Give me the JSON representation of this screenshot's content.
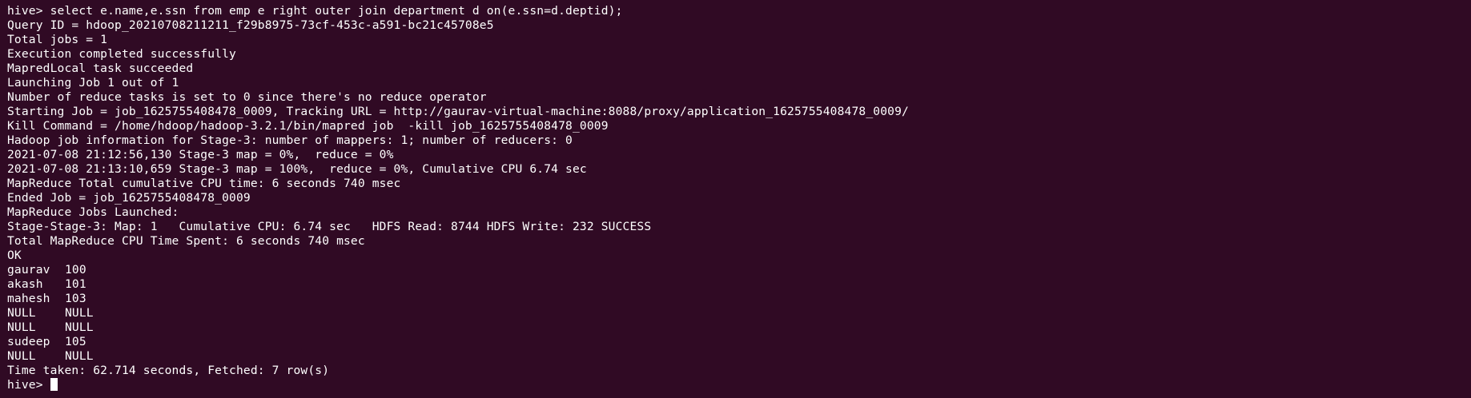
{
  "terminal": {
    "clipped_top_line": "",
    "lines_before_table": [
      "hive> select e.name,e.ssn from emp e right outer join department d on(e.ssn=d.deptid);",
      "Query ID = hdoop_20210708211211_f29b8975-73cf-453c-a591-bc21c45708e5",
      "Total jobs = 1",
      "Execution completed successfully",
      "MapredLocal task succeeded",
      "Launching Job 1 out of 1",
      "Number of reduce tasks is set to 0 since there's no reduce operator",
      "Starting Job = job_1625755408478_0009, Tracking URL = http://gaurav-virtual-machine:8088/proxy/application_1625755408478_0009/",
      "Kill Command = /home/hdoop/hadoop-3.2.1/bin/mapred job  -kill job_1625755408478_0009",
      "Hadoop job information for Stage-3: number of mappers: 1; number of reducers: 0",
      "2021-07-08 21:12:56,130 Stage-3 map = 0%,  reduce = 0%",
      "2021-07-08 21:13:10,659 Stage-3 map = 100%,  reduce = 0%, Cumulative CPU 6.74 sec",
      "MapReduce Total cumulative CPU time: 6 seconds 740 msec",
      "Ended Job = job_1625755408478_0009",
      "MapReduce Jobs Launched:",
      "Stage-Stage-3: Map: 1   Cumulative CPU: 6.74 sec   HDFS Read: 8744 HDFS Write: 232 SUCCESS",
      "Total MapReduce CPU Time Spent: 6 seconds 740 msec",
      "OK"
    ],
    "result_rows": [
      {
        "name": "gaurav",
        "ssn": "100"
      },
      {
        "name": "akash",
        "ssn": "101"
      },
      {
        "name": "mahesh",
        "ssn": "103"
      },
      {
        "name": "NULL",
        "ssn": "NULL"
      },
      {
        "name": "NULL",
        "ssn": "NULL"
      },
      {
        "name": "sudeep",
        "ssn": "105"
      },
      {
        "name": "NULL",
        "ssn": "NULL"
      }
    ],
    "summary_line": "Time taken: 62.714 seconds, Fetched: 7 row(s)",
    "prompt": "hive> ",
    "colors": {
      "background": "#300a24",
      "foreground": "#ffffff",
      "cursor": "#ffffff"
    }
  }
}
